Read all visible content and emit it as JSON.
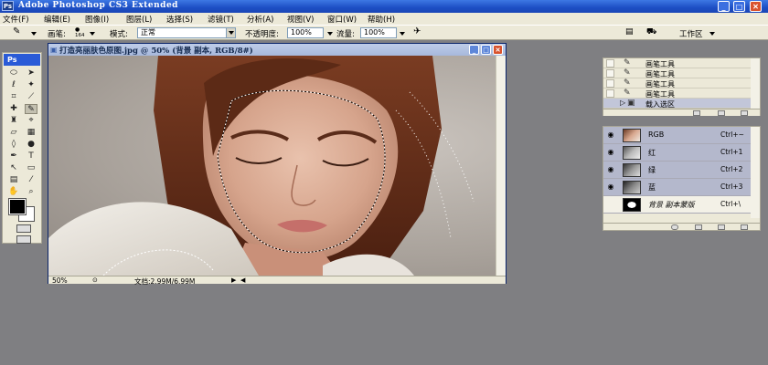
{
  "app": {
    "title": "Adobe Photoshop CS3 Extended",
    "logo": "Ps"
  },
  "window_controls": {
    "minimize": "_",
    "maximize": "□",
    "close": "✕"
  },
  "menu": [
    "文件(F)",
    "编辑(E)",
    "图像(I)",
    "图层(L)",
    "选择(S)",
    "滤镜(T)",
    "分析(A)",
    "视图(V)",
    "窗口(W)",
    "帮助(H)"
  ],
  "options_bar": {
    "brush_label": "画笔:",
    "brush_size": "164",
    "mode_label": "模式:",
    "mode_value": "正常",
    "opacity_label": "不透明度:",
    "opacity_value": "100%",
    "flow_label": "流量:",
    "flow_value": "100%",
    "workspace_label": "工作区"
  },
  "toolbox": {
    "header": "Ps"
  },
  "document": {
    "title": "打造亮丽肤色原图.jpg @ 50% (背景 副本, RGB/8#)",
    "zoom": "50%",
    "doc_size": "文档:2.99M/6.99M"
  },
  "history": {
    "items": [
      "画笔工具",
      "画笔工具",
      "画笔工具",
      "画笔工具",
      "载入选区"
    ]
  },
  "channels": {
    "items": [
      {
        "name": "RGB",
        "shortcut": "Ctrl+~"
      },
      {
        "name": "红",
        "shortcut": "Ctrl+1"
      },
      {
        "name": "绿",
        "shortcut": "Ctrl+2"
      },
      {
        "name": "蓝",
        "shortcut": "Ctrl+3"
      },
      {
        "name": "背景 副本蒙版",
        "shortcut": "Ctrl+\\"
      }
    ]
  },
  "colors": {
    "title_bar": "#1d4fc4",
    "ui_chrome": "#ece9d8",
    "workspace": "#7f7f82",
    "close_button": "#d9532f"
  }
}
